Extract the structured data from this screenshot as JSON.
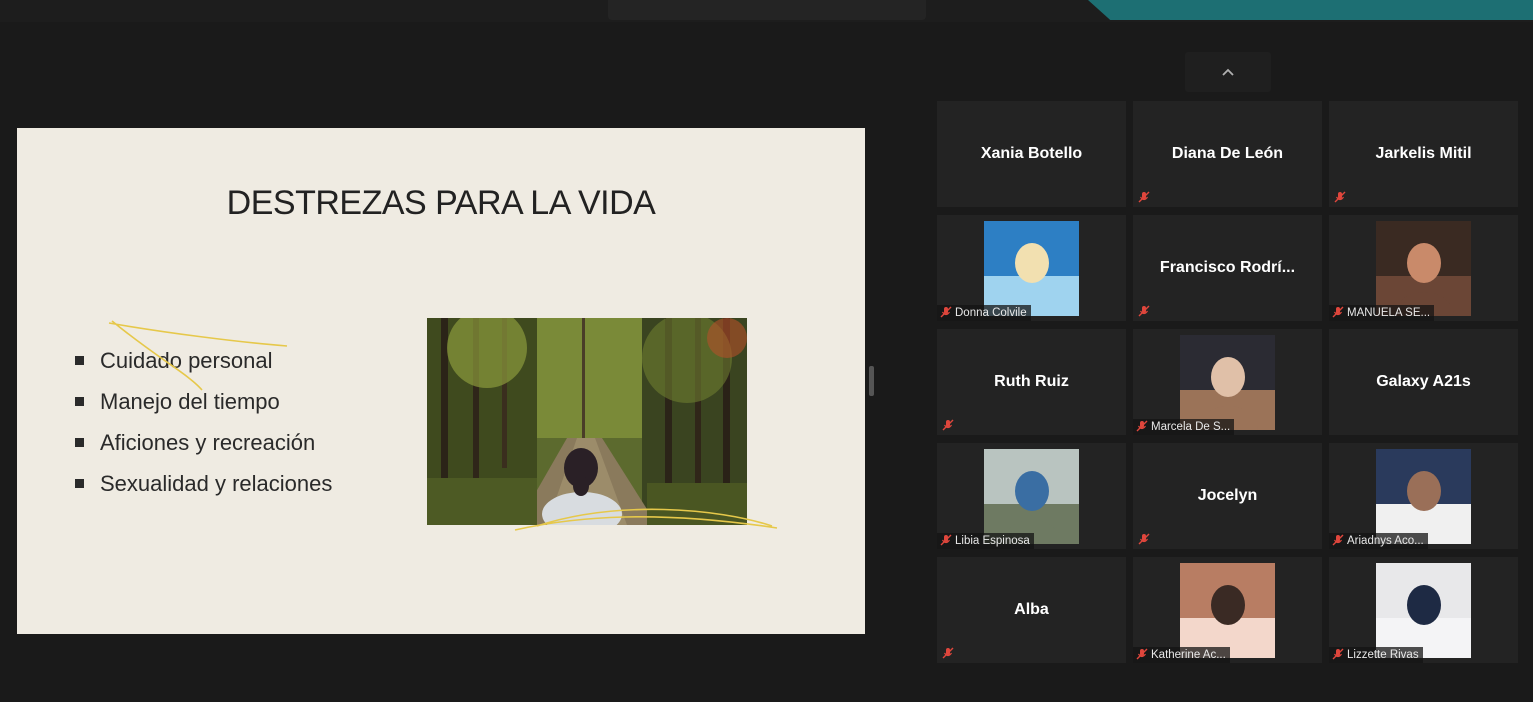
{
  "slide": {
    "title": "DESTREZAS PARA LA VIDA",
    "bullets": [
      "Cuidado personal",
      "Manejo del tiempo",
      "Aficiones y recreación",
      "Sexualidad y relaciones"
    ]
  },
  "gallery": {
    "participants": [
      {
        "name": "Xania Botello",
        "video": false,
        "muted": false
      },
      {
        "name": "Diana De León",
        "video": false,
        "muted": true
      },
      {
        "name": "Jarkelis Mitil",
        "video": false,
        "muted": true
      },
      {
        "name": "Donna Colvile",
        "video": true,
        "muted": true
      },
      {
        "name": "Francisco  Rodrí...",
        "video": false,
        "muted": true
      },
      {
        "name": "MANUELA SE...",
        "video": true,
        "muted": true
      },
      {
        "name": "Ruth Ruiz",
        "video": false,
        "muted": true
      },
      {
        "name": "Marcela De S...",
        "video": true,
        "muted": true
      },
      {
        "name": "Galaxy A21s",
        "video": false,
        "muted": false
      },
      {
        "name": "Libia Espinosa",
        "video": true,
        "muted": true
      },
      {
        "name": "Jocelyn",
        "video": false,
        "muted": true
      },
      {
        "name": "Ariadnys Aco...",
        "video": true,
        "muted": true
      },
      {
        "name": "Alba",
        "video": false,
        "muted": true
      },
      {
        "name": "Katherine Ac...",
        "video": true,
        "muted": true
      },
      {
        "name": "Lizzette Rivas",
        "video": true,
        "muted": true
      }
    ]
  },
  "colors": {
    "accent": "#1d6f73",
    "muted_mic": "#e0463c",
    "tile": "#232323"
  }
}
